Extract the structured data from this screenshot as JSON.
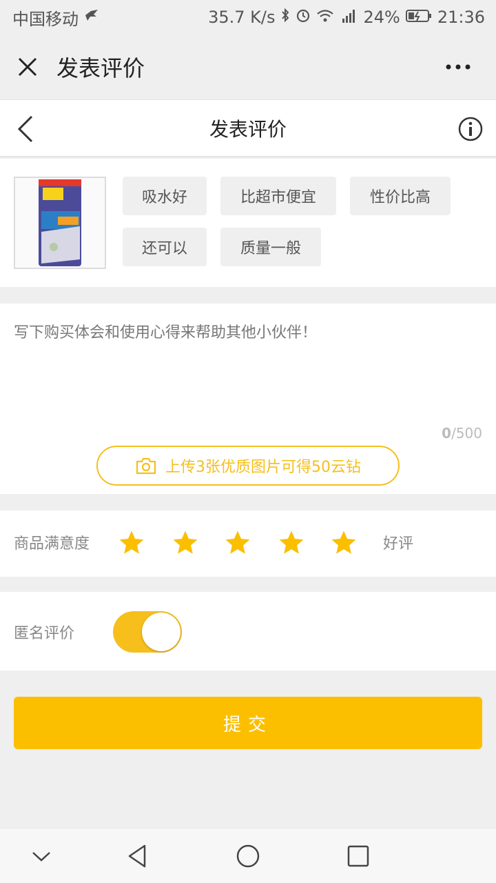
{
  "status_bar": {
    "carrier": "中国移动",
    "speed": "35.7 K/s",
    "battery": "24%",
    "time": "21:36",
    "icons": [
      "bluetooth-icon",
      "alarm-icon",
      "wifi-icon",
      "signal-4g-icon",
      "battery-charging-icon"
    ]
  },
  "appbar": {
    "title": "发表评价",
    "close_icon": "close-icon",
    "more_icon": "more-icon"
  },
  "page_header": {
    "title": "发表评价",
    "back_icon": "chevron-left-icon",
    "info_icon": "info-icon"
  },
  "product": {
    "image": "product-thumbnail",
    "tags": [
      "吸水好",
      "比超市便宜",
      "性价比高",
      "还可以",
      "质量一般"
    ]
  },
  "comment": {
    "placeholder": "写下购买体会和使用心得来帮助其他小伙伴！",
    "count_current": "0",
    "count_max": "/500"
  },
  "upload": {
    "label": "上传3张优质图片可得50云钻",
    "icon": "camera-icon"
  },
  "rating": {
    "label": "商品满意度",
    "stars": 5,
    "max_stars": 5,
    "result": "好评",
    "star_color": "#fbbf00"
  },
  "anonymous": {
    "label": "匿名评价",
    "enabled": true
  },
  "submit": {
    "label": "提交"
  },
  "colors": {
    "accent": "#fbbf00",
    "accent_outline": "#f6bf1c"
  }
}
